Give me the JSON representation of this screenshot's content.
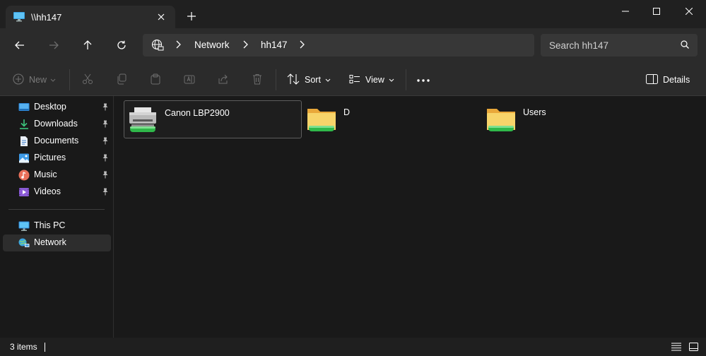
{
  "window": {
    "tab_title": "\\\\hh147",
    "controls": {
      "minimize": "minimize-icon",
      "maximize": "maximize-icon",
      "close": "close-icon"
    }
  },
  "address": {
    "segments": [
      "Network",
      "hh147"
    ]
  },
  "search": {
    "placeholder": "Search hh147"
  },
  "commands": {
    "new_label": "New",
    "sort_label": "Sort",
    "view_label": "View",
    "details_label": "Details"
  },
  "sidebar": {
    "quick_access": [
      {
        "label": "Desktop",
        "icon": "desktop-icon",
        "pinned": true
      },
      {
        "label": "Downloads",
        "icon": "downloads-icon",
        "pinned": true
      },
      {
        "label": "Documents",
        "icon": "documents-icon",
        "pinned": true
      },
      {
        "label": "Pictures",
        "icon": "pictures-icon",
        "pinned": true
      },
      {
        "label": "Music",
        "icon": "music-icon",
        "pinned": true
      },
      {
        "label": "Videos",
        "icon": "videos-icon",
        "pinned": true
      }
    ],
    "locations": [
      {
        "label": "This PC",
        "icon": "this-pc-icon",
        "selected": false
      },
      {
        "label": "Network",
        "icon": "network-icon",
        "selected": true
      }
    ]
  },
  "items": [
    {
      "label": "Canon LBP2900",
      "icon": "printer-icon",
      "selected": true
    },
    {
      "label": "D",
      "icon": "shared-folder-icon",
      "selected": false
    },
    {
      "label": "Users",
      "icon": "shared-folder-icon",
      "selected": false
    }
  ],
  "status": {
    "count_text": "3 items"
  },
  "colors": {
    "accent": "#0078d4",
    "folder": "#f2c14e",
    "share_bar": "#2fb84a"
  }
}
